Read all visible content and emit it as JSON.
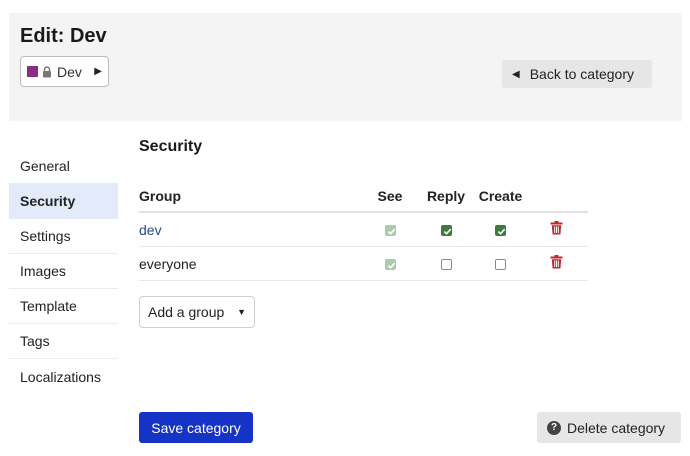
{
  "header": {
    "title": "Edit: Dev",
    "category_badge": {
      "label": "Dev",
      "color": "#8a2b86"
    },
    "back_label": "Back to category"
  },
  "nav": {
    "items": [
      {
        "label": "General",
        "active": false
      },
      {
        "label": "Security",
        "active": true
      },
      {
        "label": "Settings",
        "active": false
      },
      {
        "label": "Images",
        "active": false
      },
      {
        "label": "Template",
        "active": false
      },
      {
        "label": "Tags",
        "active": false
      },
      {
        "label": "Localizations",
        "active": false
      }
    ]
  },
  "security": {
    "title": "Security",
    "columns": {
      "group": "Group",
      "see": "See",
      "reply": "Reply",
      "create": "Create"
    },
    "rows": [
      {
        "group": "dev",
        "see": "checked-disabled",
        "reply": "checked",
        "create": "checked"
      },
      {
        "group": "everyone",
        "see": "checked-disabled",
        "reply": "unchecked",
        "create": "unchecked"
      }
    ],
    "add_group_label": "Add a group"
  },
  "footer": {
    "save_label": "Save category",
    "delete_label": "Delete category"
  },
  "colors": {
    "primary": "#1533c5",
    "checked": "#3d7a3d",
    "danger": "#c0282d",
    "link": "#1e4b8f"
  }
}
